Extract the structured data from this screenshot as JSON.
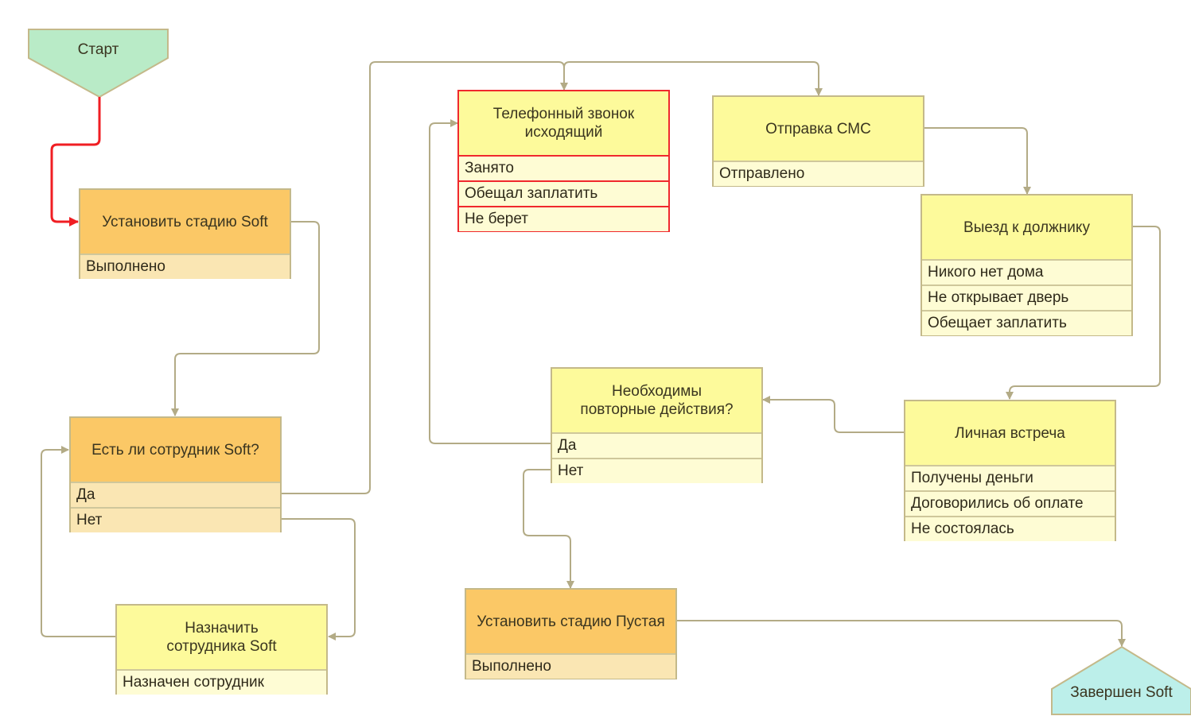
{
  "diagram": {
    "colors": {
      "connector": "#b3ab86",
      "active_connector": "#f01e23",
      "start_fill": "#b9ebc7",
      "end_fill": "#bcefea",
      "action_fill": "#fbc866",
      "task_fill": "#fdfa9b",
      "selected_border": "#f0282d"
    },
    "start": {
      "label": "Старт"
    },
    "end": {
      "label": "Завершен Soft"
    },
    "nodes": {
      "set_stage_soft": {
        "title": "Установить стадию Soft",
        "outcomes": [
          "Выполнено"
        ]
      },
      "has_employee": {
        "title": "Есть ли сотрудник Soft?",
        "outcomes": [
          "Да",
          "Нет"
        ]
      },
      "assign_employee": {
        "title": "Назначить сотрудника Soft",
        "outcomes": [
          "Назначен сотрудник"
        ]
      },
      "phone_call": {
        "title": "Телефонный звонок исходящий",
        "outcomes": [
          "Занято",
          "Обещал заплатить",
          "Не берет"
        ]
      },
      "send_sms": {
        "title": "Отправка СМС",
        "outcomes": [
          "Отправлено"
        ]
      },
      "visit_debtor": {
        "title": "Выезд к должнику",
        "outcomes": [
          "Никого нет дома",
          "Не открывает дверь",
          "Обещает заплатить"
        ]
      },
      "repeat_needed": {
        "title": "Необходимы повторные действия?",
        "outcomes": [
          "Да",
          "Нет"
        ]
      },
      "personal_meeting": {
        "title": "Личная встреча",
        "outcomes": [
          "Получены деньги",
          "Договорились об оплате",
          "Не состоялась"
        ]
      },
      "set_stage_empty": {
        "title": "Установить стадию Пустая",
        "outcomes": [
          "Выполнено"
        ]
      }
    }
  }
}
